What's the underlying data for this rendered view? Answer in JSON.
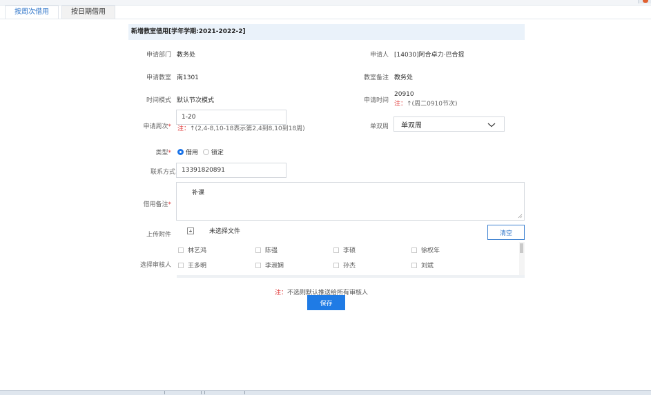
{
  "tabs": [
    {
      "label": "按周次借用",
      "active": true
    },
    {
      "label": "按日期借用",
      "active": false
    }
  ],
  "header": {
    "title": "新增教室借用[学年学期:2021-2022-2]"
  },
  "fields": {
    "dept_label": "申请部门",
    "dept_value": "教务处",
    "applicant_label": "申请人",
    "applicant_value": "[14030]阿合卓力·巴合提",
    "room_label": "申请教室",
    "room_value": "南1301",
    "room_note_label": "教室备注",
    "room_note_value": "教务处",
    "time_mode_label": "时间模式",
    "time_mode_value": "默认节次模式",
    "apply_time_label": "申请时间",
    "apply_time_value": "20910",
    "apply_time_note_prefix": "注：",
    "apply_time_note": "↑(周二0910节次)",
    "weeks_label": "申请周次",
    "weeks_value": "1-20",
    "weeks_note_prefix": "注：",
    "weeks_note": "↑(2,4-8,10-18表示第2,4到8,10到18周)",
    "parity_label": "单双周",
    "parity_value": "单双周",
    "type_label": "类型",
    "type_options": [
      "借用",
      "锁定"
    ],
    "contact_label": "联系方式",
    "contact_value": "13391820891",
    "remark_label": "借用备注",
    "remark_value": "补课",
    "upload_label": "上传附件",
    "upload_status": "未选择文件",
    "clear_label": "清空",
    "reviewer_label": "选择审核人",
    "reviewers": [
      "林艺鸿",
      "陈强",
      "李硕",
      "徐权年",
      "王多明",
      "李淑娴",
      "孙杰",
      "刘斌"
    ],
    "footer_note_prefix": "注：",
    "footer_note": "不选则默认推送给所有审核人",
    "save_label": "保存"
  },
  "colors": {
    "accent": "#1f7be5",
    "required": "#e03a3a",
    "header_bg": "#eaf2fa"
  }
}
